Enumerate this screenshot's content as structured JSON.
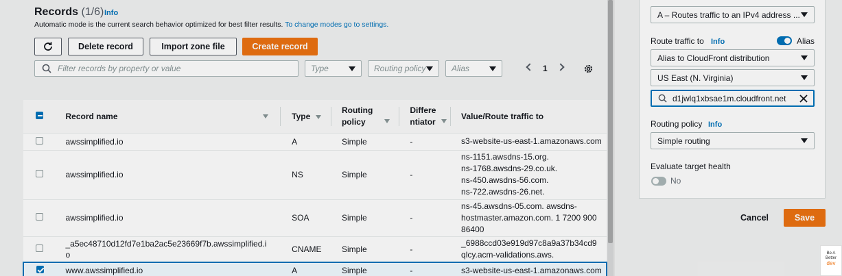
{
  "records": {
    "title": "Records",
    "count": "(1/6)",
    "info": "Info",
    "description": "Automatic mode is the current search behavior optimized for best filter results.",
    "description_link": "To change modes go to settings."
  },
  "toolbar": {
    "delete_label": "Delete record",
    "import_label": "Import zone file",
    "create_label": "Create record"
  },
  "filters": {
    "search_placeholder": "Filter records by property or value",
    "type_placeholder": "Type",
    "routing_placeholder": "Routing policy",
    "alias_placeholder": "Alias",
    "page": "1"
  },
  "table": {
    "headers": {
      "name": "Record name",
      "type": "Type",
      "routing": [
        "Routing",
        "policy"
      ],
      "differentiator": [
        "Differe",
        "ntiator"
      ],
      "value": "Value/Route traffic to"
    },
    "rows": [
      {
        "name": [
          "awssimplified.io"
        ],
        "type": "A",
        "routing": "Simple",
        "diff": "-",
        "value": [
          "s3-website-us-east-1.amazonaws.com"
        ],
        "checked": false
      },
      {
        "name": [
          "awssimplified.io"
        ],
        "type": "NS",
        "routing": "Simple",
        "diff": "-",
        "value": [
          "ns-1151.awsdns-15.org.",
          "ns-1768.awsdns-29.co.uk.",
          "ns-450.awsdns-56.com.",
          "ns-722.awsdns-26.net."
        ],
        "checked": false
      },
      {
        "name": [
          "awssimplified.io"
        ],
        "type": "SOA",
        "routing": "Simple",
        "diff": "-",
        "value": [
          "ns-45.awsdns-05.com. awsdns-",
          "hostmaster.amazon.com. 1 7200 900",
          "86400"
        ],
        "checked": false
      },
      {
        "name": [
          "_a5ec48710d12fd7e1ba2ac5e23669f7b.awssimplified.i",
          "o"
        ],
        "type": "CNAME",
        "routing": "Simple",
        "diff": "-",
        "value": [
          "_6988ccd03e919d97c8a9a37b34cd9",
          "qlcy.acm-validations.aws."
        ],
        "checked": false
      },
      {
        "name": [
          "www.awssimplified.io"
        ],
        "type": "A",
        "routing": "Simple",
        "diff": "-",
        "value": [
          "s3-website-us-east-1.amazonaws.com"
        ],
        "checked": true
      }
    ]
  },
  "panel": {
    "record_type_value": "A – Routes traffic to an IPv4 address ...",
    "route_label": "Route traffic to",
    "info": "Info",
    "alias_label": "Alias",
    "alias_on": true,
    "endpoint_value": "Alias to CloudFront distribution",
    "region_value": "US East (N. Virginia)",
    "distribution_value": "d1jwlq1xbsae1m.cloudfront.net",
    "routing_label": "Routing policy",
    "routing_value": "Simple routing",
    "health_label": "Evaluate target health",
    "health_value": "No",
    "cancel_label": "Cancel",
    "save_label": "Save"
  },
  "watermark": {
    "text": [
      "Be A",
      "Better",
      "dev"
    ]
  },
  "colors": {
    "accent": "#ec7211",
    "link": "#0073bb",
    "border": "#aab7b8"
  }
}
